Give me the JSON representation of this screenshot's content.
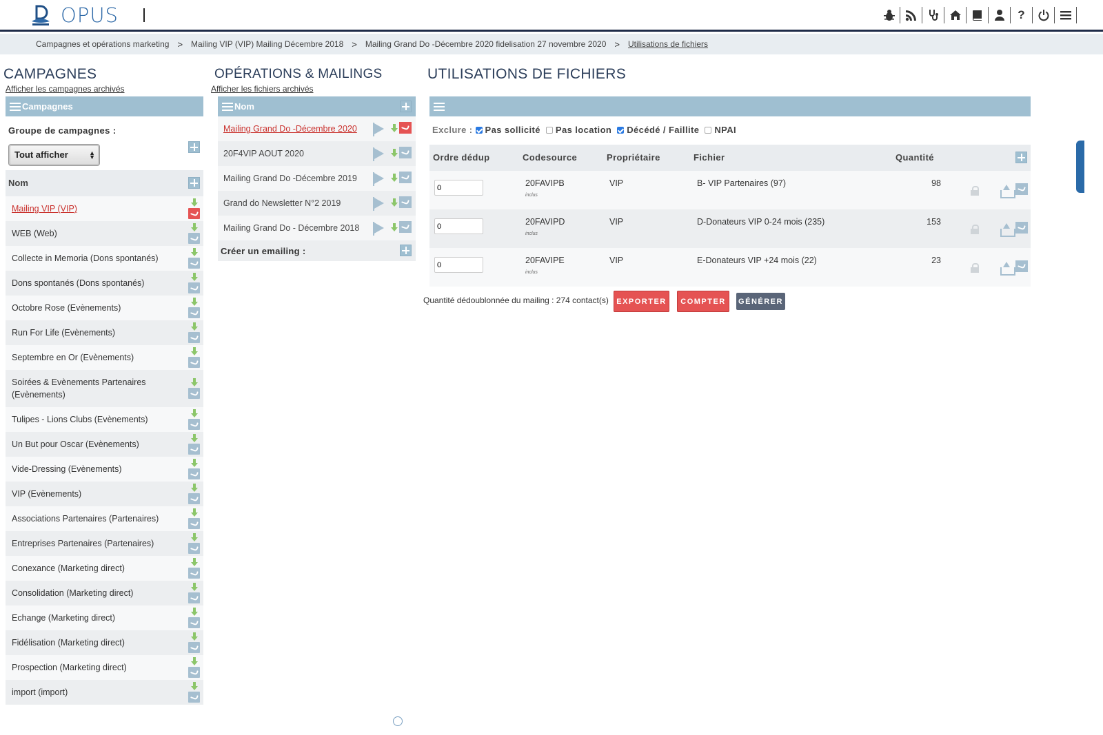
{
  "app": {
    "name": "OPUS"
  },
  "top_icons": [
    "bug-icon",
    "rss-icon",
    "stethoscope-icon",
    "home-icon",
    "book-icon",
    "user-icon",
    "help-icon",
    "power-icon",
    "menu-icon"
  ],
  "breadcrumb": [
    "Campagnes et opérations marketing",
    "Mailing VIP (VIP) Mailing Décembre 2018",
    "Mailing Grand Do -Décembre 2020 fidelisation 27 novembre 2020",
    "Utilisations de fichiers"
  ],
  "breadcrumb_sep": ">",
  "campaigns": {
    "title": "CAMPAGNES",
    "archived_link": "Afficher les campagnes archivés",
    "bar_label": "Campagnes",
    "group_label": "Groupe de campagnes :",
    "group_select": "Tout afficher",
    "list_header": "Nom",
    "items": [
      "Mailing VIP (VIP)",
      "WEB (Web)",
      "Collecte in Memoria (Dons spontanés)",
      "Dons spontanés (Dons spontanés)",
      "Octobre Rose (Evènements)",
      "Run For Life (Evènements)",
      "Septembre en Or (Evènements)",
      "Soirées & Evènements Partenaires (Evènements)",
      "Tulipes - Lions Clubs (Evènements)",
      "Un But pour Oscar (Evènements)",
      "Vide-Dressing (Evènements)",
      "VIP (Evènements)",
      "Associations Partenaires (Partenaires)",
      "Entreprises Partenaires (Partenaires)",
      "Conexance (Marketing direct)",
      "Consolidation (Marketing direct)",
      "Echange (Marketing direct)",
      "Fidélisation (Marketing direct)",
      "Prospection (Marketing direct)",
      "import (import)"
    ]
  },
  "operations": {
    "title": "OPÉRATIONS & MAILINGS",
    "archived_link": "Afficher les fichiers archivés",
    "bar_label": "Nom",
    "items": [
      "Mailing Grand Do -Décembre 2020",
      "20F4VIP AOUT 2020",
      "Mailing Grand Do -Décembre 2019",
      "Grand do Newsletter N°2 2019",
      "Mailing Grand Do - Décembre 2018"
    ],
    "create_label": "Créer un emailing :"
  },
  "files": {
    "title": "UTILISATIONS DE FICHIERS",
    "exclude_label": "Exclure :",
    "exclude_options": [
      {
        "label": "Pas sollicité",
        "checked": true
      },
      {
        "label": "Pas location",
        "checked": false
      },
      {
        "label": "Décédé / Faillite",
        "checked": true
      },
      {
        "label": "NPAI",
        "checked": false
      }
    ],
    "columns": [
      "Ordre dédup",
      "Codesource",
      "Propriétaire",
      "Fichier",
      "Quantité"
    ],
    "rows": [
      {
        "order": "0",
        "code": "20FAVIPB",
        "note": "inclus",
        "owner": "VIP",
        "file": "B- VIP Partenaires (97)",
        "qty": "98"
      },
      {
        "order": "0",
        "code": "20FAVIPD",
        "note": "inclus",
        "owner": "VIP",
        "file": "D-Donateurs VIP 0-24 mois (235)",
        "qty": "153"
      },
      {
        "order": "0",
        "code": "20FAVIPE",
        "note": "inclus",
        "owner": "VIP",
        "file": "E-Donateurs VIP +24 mois (22)",
        "qty": "23"
      }
    ],
    "dedup_text": "Quantité dédoublonnée du mailing : 274 contact(s)",
    "buttons": {
      "export": "EXPORTER",
      "count": "COMPTER",
      "generate": "GÉNÉRER"
    }
  },
  "colors": {
    "header_bar": "#9fbfd1",
    "accent_red": "#e55353",
    "nav_dark": "#1f2c48",
    "logo_blue": "#2f6aa8"
  }
}
